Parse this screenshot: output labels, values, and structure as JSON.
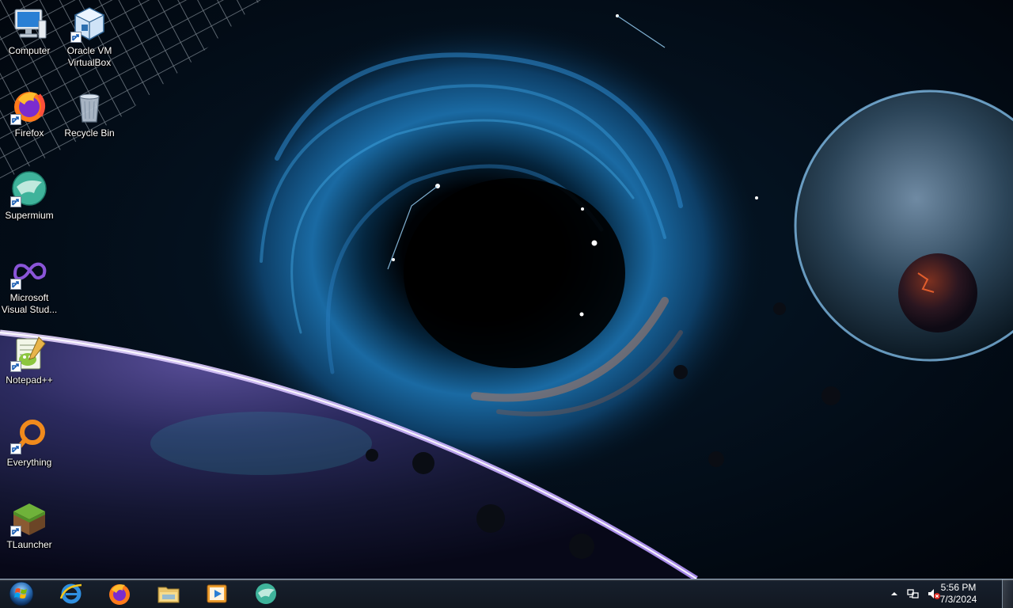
{
  "desktop": {
    "icons": [
      {
        "label": "Computer",
        "icon": "computer-icon",
        "shortcut": false
      },
      {
        "label": "Oracle VM\nVirtualBox",
        "icon": "virtualbox-icon",
        "shortcut": true
      },
      {
        "label": "Firefox",
        "icon": "firefox-icon",
        "shortcut": true
      },
      {
        "label": "Recycle Bin",
        "icon": "recycle-bin-icon",
        "shortcut": false
      },
      {
        "label": "Supermium",
        "icon": "supermium-icon",
        "shortcut": true
      },
      {
        "label": "Microsoft\nVisual Stud...",
        "icon": "visual-studio-icon",
        "shortcut": true
      },
      {
        "label": "Notepad++",
        "icon": "notepad-plus-plus-icon",
        "shortcut": true
      },
      {
        "label": "Everything",
        "icon": "everything-search-icon",
        "shortcut": true
      },
      {
        "label": "TLauncher",
        "icon": "tlauncher-icon",
        "shortcut": true
      }
    ]
  },
  "taskbar": {
    "start": {
      "icon": "windows-start-orb-icon"
    },
    "pinned": [
      {
        "icon": "internet-explorer-icon"
      },
      {
        "icon": "firefox-icon"
      },
      {
        "icon": "file-explorer-icon"
      },
      {
        "icon": "media-player-icon"
      },
      {
        "icon": "supermium-icon"
      }
    ],
    "tray": {
      "icons": [
        "show-hidden-icons-arrow",
        "network-icon",
        "volume-muted-icon"
      ],
      "time": "5:56 PM",
      "date": "7/3/2024"
    }
  },
  "colors": {
    "wallpaper_dark": "#02060d",
    "wallpaper_accent": "#1f6fb0",
    "taskbar": "#1c2430",
    "icon_label": "#ffffff"
  }
}
